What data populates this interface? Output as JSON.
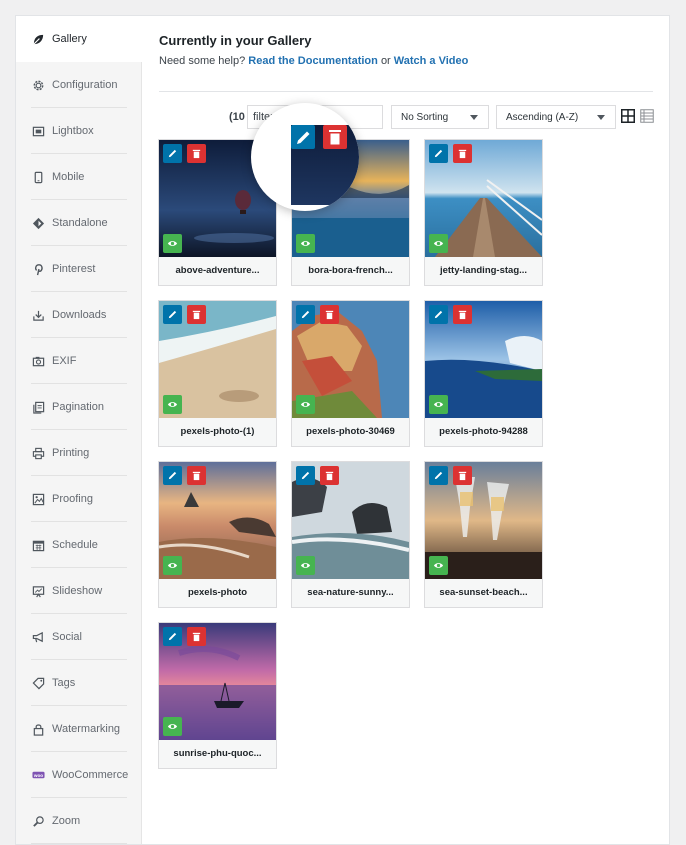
{
  "sidebar": {
    "items": [
      {
        "label": "Gallery",
        "icon": "leaf-icon",
        "active": true
      },
      {
        "label": "Configuration",
        "icon": "gear-icon"
      },
      {
        "label": "Lightbox",
        "icon": "lightbox-icon"
      },
      {
        "label": "Mobile",
        "icon": "mobile-icon"
      },
      {
        "label": "Standalone",
        "icon": "standalone-icon"
      },
      {
        "label": "Pinterest",
        "icon": "pinterest-icon"
      },
      {
        "label": "Downloads",
        "icon": "download-icon"
      },
      {
        "label": "EXIF",
        "icon": "camera-icon"
      },
      {
        "label": "Pagination",
        "icon": "pagination-icon"
      },
      {
        "label": "Printing",
        "icon": "printer-icon"
      },
      {
        "label": "Proofing",
        "icon": "proofing-icon"
      },
      {
        "label": "Schedule",
        "icon": "calendar-icon"
      },
      {
        "label": "Slideshow",
        "icon": "slideshow-icon"
      },
      {
        "label": "Social",
        "icon": "megaphone-icon"
      },
      {
        "label": "Tags",
        "icon": "tag-icon"
      },
      {
        "label": "Watermarking",
        "icon": "lock-icon"
      },
      {
        "label": "WooCommerce",
        "icon": "woocommerce-icon"
      },
      {
        "label": "Zoom",
        "icon": "zoom-icon"
      }
    ]
  },
  "main": {
    "title": "Currently in your Gallery",
    "help_prefix": "Need some help?",
    "help_link1": "Read the Documentation",
    "help_or": "or",
    "help_link2": "Watch a Video",
    "count_text": "(10",
    "filter_value": "filter",
    "sort_by": "No Sorting",
    "sort_order": "Ascending (A-Z)"
  },
  "images": [
    {
      "name": "above-adventure..."
    },
    {
      "name": "bora-bora-french..."
    },
    {
      "name": "jetty-landing-stag..."
    },
    {
      "name": "pexels-photo-(1)"
    },
    {
      "name": "pexels-photo-30469"
    },
    {
      "name": "pexels-photo-94288"
    },
    {
      "name": "pexels-photo"
    },
    {
      "name": "sea-nature-sunny..."
    },
    {
      "name": "sea-sunset-beach..."
    },
    {
      "name": "sunrise-phu-quoc..."
    }
  ],
  "colors": {
    "edit": "#0073aa",
    "delete": "#dc3232",
    "visible": "#46b450",
    "link": "#2271b1"
  }
}
